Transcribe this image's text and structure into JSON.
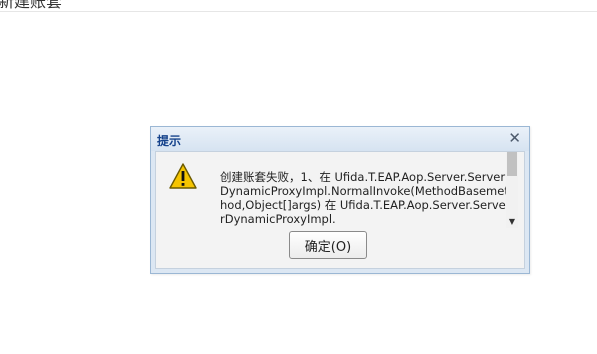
{
  "page": {
    "title": "新建账套"
  },
  "dialog": {
    "title": "提示",
    "close_glyph": "✕",
    "icon": "warning-icon",
    "message": "创建账套失败，1、在 Ufida.T.EAP.Aop.Server.ServerDynamicProxyImpl.NormalInvoke(MethodBasemethod,Object[]args) 在 Ufida.T.EAP.Aop.Server.ServerDynamicProxyImpl.",
    "ok_label": "确定(O)",
    "scroll_down_glyph": "▼"
  },
  "colors": {
    "title_text": "#15428b",
    "dialog_frame": "#dce7f3",
    "dialog_body": "#f3f3f3",
    "warning_fill": "#f5c400"
  }
}
